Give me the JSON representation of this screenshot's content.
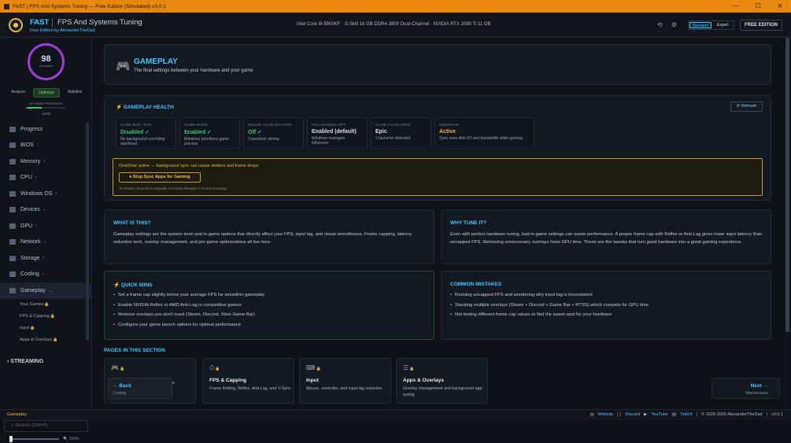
{
  "window": {
    "title": "FAST | FPS And Systems Tuning — Free Edition (Simulated) v3.0.1",
    "min": "—",
    "max": "☐",
    "close": "✕"
  },
  "header": {
    "app_name": "FAST",
    "app_subtitle": "FPS And Systems Tuning",
    "edition_line": "Free Edition by AlexanderTheDad",
    "system_info": "Intel Core i9-9900KF  ·  G.Skill 16 GB DDR4-3900 Dual-Channel  ·  NVIDIA RTX 2080 Ti 11 GB",
    "mode_standard": "Standard",
    "mode_expert": "Expert",
    "edition_badge": "FREE EDITION",
    "history_icon": "⟲",
    "settings_icon": "⚙"
  },
  "sidebar": {
    "score": "98",
    "score_label": "Excellent",
    "phases": [
      "Analyze",
      "Optimize",
      "Stabilize"
    ],
    "optimize_label": "OPTIMIZE PROGRESS",
    "progress_count": "18/45",
    "progress_fraction": 0.4,
    "nav": [
      {
        "label": "Progress",
        "chev": ""
      },
      {
        "label": "BIOS",
        "chev": "›"
      },
      {
        "label": "Memory",
        "chev": "›"
      },
      {
        "label": "CPU",
        "chev": "›"
      },
      {
        "label": "Windows OS",
        "chev": "›"
      },
      {
        "label": "Devices",
        "chev": "›"
      },
      {
        "label": "GPU",
        "chev": "›"
      },
      {
        "label": "Network",
        "chev": "›"
      },
      {
        "label": "Storage",
        "chev": "›"
      },
      {
        "label": "Cooling",
        "chev": "›"
      },
      {
        "label": "Gameplay",
        "chev": "⌄"
      }
    ],
    "sub": [
      "Your Games",
      "FPS & Capping",
      "Input",
      "Apps & Overlays"
    ],
    "lock": "🔒",
    "streaming": "STREAMING",
    "search_placeholder": "Search (Ctrl+F)",
    "zoom": "100%",
    "zoom_icon": "🔍"
  },
  "hero": {
    "icon": "🎮",
    "title": "GAMEPLAY",
    "subtitle": "The final settings between your hardware and your game"
  },
  "health": {
    "title": "GAMEPLAY HEALTH",
    "refresh": "Refresh",
    "refresh_icon": "⟳",
    "bolt": "⚡",
    "cards": [
      {
        "label": "GAME BAR / DVR",
        "value": "Disabled ✓",
        "desc": "No background recording overhead",
        "color": "#3cc36b"
      },
      {
        "label": "GAME MODE",
        "value": "Enabled ✓",
        "desc": "Windows prioritizes game process",
        "color": "#3cc36b"
      },
      {
        "label": "MOUSE ACCELERATION",
        "value": "Off ✓",
        "desc": "Consistent aiming",
        "color": "#3cc36b"
      },
      {
        "label": "FULLSCREEN OPT.",
        "value": "Enabled (default)",
        "desc": "Windows manages fullscreen",
        "color": "#d8dce4"
      },
      {
        "label": "GAME LAUNCHERS",
        "value": "Epic",
        "desc": "1 launcher detected",
        "color": "#d8dce4"
      },
      {
        "label": "ONEDRIVE",
        "value": "Active",
        "desc": "Sync uses disk I/O and bandwidth while gaming",
        "color": "#e8b83a"
      }
    ],
    "warning_text": "OneDrive active — background sync can cause stutters and frame drops.",
    "warning_button": "Stop Sync Apps for Gaming",
    "warning_button_icon": "⏸",
    "warning_note": "To restart, relaunch it manually or restart Windows if it runs at startup."
  },
  "what": {
    "title": "WHAT IS THIS?",
    "body": "Gameplay settings are the system-level and in-game options that directly affect your FPS, input lag, and visual smoothness. Frame capping, latency reduction tech, overlay management, and per-game optimizations all live here."
  },
  "why": {
    "title": "WHY TUNE IT?",
    "body": "Even with perfect hardware tuning, bad in-game settings can waste performance. A proper frame cap with Reflex or Anti-Lag gives lower input latency than uncapped FPS. Removing unnecessary overlays frees GPU time. These are the tweaks that turn good hardware into a great gaming experience."
  },
  "quick": {
    "title": "QUICK WINS",
    "items": [
      "Set a frame cap slightly below your average FPS for smoother gameplay",
      "Enable NVIDIA Reflex or AMD Anti-Lag in competitive games",
      "Remove overlays you don't need (Steam, Discord, Xbox Game Bar)",
      "Configure your game launch options for optimal performance"
    ]
  },
  "mistakes": {
    "title": "COMMON MISTAKES",
    "items": [
      "Running uncapped FPS and wondering why input lag is inconsistent",
      "Stacking multiple overlays (Steam + Discord + Game Bar + RTSS) which compete for GPU time",
      "Not testing different frame cap values to find the sweet spot for your hardware"
    ]
  },
  "pages": {
    "title": "PAGES IN THIS SECTION",
    "cards": [
      {
        "icon": "🎮",
        "title": "Your Games",
        "desc": "",
        "peek": "e"
      },
      {
        "icon": "⏱",
        "title": "FPS & Capping",
        "desc": "Frame limiting, Reflex, Anti-Lag, and V-Sync"
      },
      {
        "icon": "⌨",
        "title": "Input",
        "desc": "Mouse, controller, and input lag reduction"
      },
      {
        "icon": "☰",
        "title": "Apps & Overlays",
        "desc": "Overlay management and background app tuning"
      }
    ]
  },
  "back": {
    "label": "← Back",
    "sub": "Cooling"
  },
  "next": {
    "label": "Next →",
    "sub": "Maintenance"
  },
  "status": {
    "left": "Gameplay",
    "website": "Website",
    "discord": "Discord",
    "youtube": "YouTube",
    "twitch": "Twitch",
    "copyright": "© 2025-2026 AlexanderTheDad",
    "sep": "|",
    "version": "v3.0.1"
  },
  "colors": {
    "accent": "#3ec6ff",
    "title_bar": "#e8870e",
    "success": "#3cc36b",
    "warning": "#e8b83a",
    "score_ring": "#9b3ed8"
  }
}
